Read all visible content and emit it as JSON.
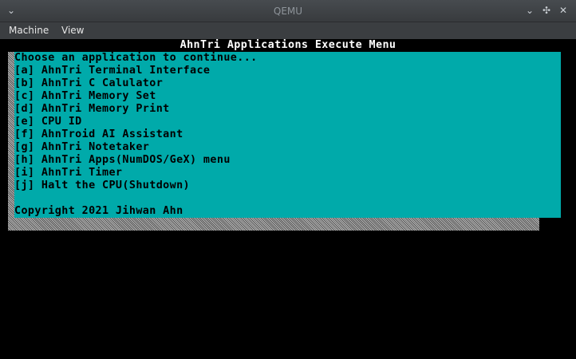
{
  "window": {
    "title": "QEMU"
  },
  "menubar": {
    "items": [
      "Machine",
      "View"
    ]
  },
  "screen": {
    "title": "AhnTri Applications Execute Menu",
    "prompt": "Choose an application to continue...",
    "options": [
      "[a] AhnTri Terminal Interface",
      "[b] AhnTri C Calulator",
      "[c] AhnTri Memory Set",
      "[d] AhnTri Memory Print",
      "[e] CPU ID",
      "[f] AhnTroid AI Assistant",
      "[g] AhnTri Notetaker",
      "[h] AhnTri Apps(NumDOS/GeX) menu",
      "[i] AhnTri Timer",
      "[j] Halt the CPU(Shutdown)"
    ],
    "copyright": "Copyright 2021 Jihwan Ahn",
    "colors": {
      "panel": "#00aaaa",
      "background": "#000000",
      "text": "#000000",
      "title_text": "#ffffff"
    }
  }
}
